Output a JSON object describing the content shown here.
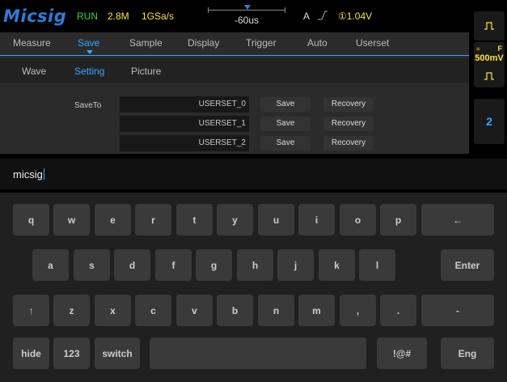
{
  "status": {
    "logo": "Micsig",
    "run": "RUN",
    "memory": "2.8M",
    "sample_rate": "1GSa/s",
    "timebase": "-60us",
    "trigger_source": "A",
    "trigger_level": "①1.04V"
  },
  "right_panel": {
    "ch1_scale": "500mV",
    "ch1_coupling": "F",
    "ch2": "2"
  },
  "menu": {
    "items": [
      "Measure",
      "Save",
      "Sample",
      "Display",
      "Trigger",
      "Auto",
      "Userset"
    ],
    "active": "Save"
  },
  "submenu": {
    "items": [
      "Wave",
      "Setting",
      "Picture"
    ],
    "active": "Setting"
  },
  "saveto": {
    "label": "SaveTo",
    "slots": [
      {
        "name": "USERSET_0",
        "save": "Save",
        "recovery": "Recovery"
      },
      {
        "name": "USERSET_1",
        "save": "Save",
        "recovery": "Recovery"
      },
      {
        "name": "USERSET_2",
        "save": "Save",
        "recovery": "Recovery"
      }
    ]
  },
  "input": {
    "value": "micsig"
  },
  "keyboard": {
    "row1": [
      "q",
      "w",
      "e",
      "r",
      "t",
      "y",
      "u",
      "i",
      "o",
      "p",
      "←"
    ],
    "row2": [
      "a",
      "s",
      "d",
      "f",
      "g",
      "h",
      "j",
      "k",
      "l",
      "Enter"
    ],
    "row3": [
      "↑",
      "z",
      "x",
      "c",
      "v",
      "b",
      "n",
      "m",
      ",",
      ".",
      "-"
    ],
    "row4": [
      "hide",
      "123",
      "switch",
      "",
      "!@#",
      "Eng"
    ]
  },
  "colors": {
    "accent": "#3aa6ff",
    "logo": "#2f7bd9",
    "run": "#2fdc4a",
    "yellow": "#ffe23a"
  }
}
